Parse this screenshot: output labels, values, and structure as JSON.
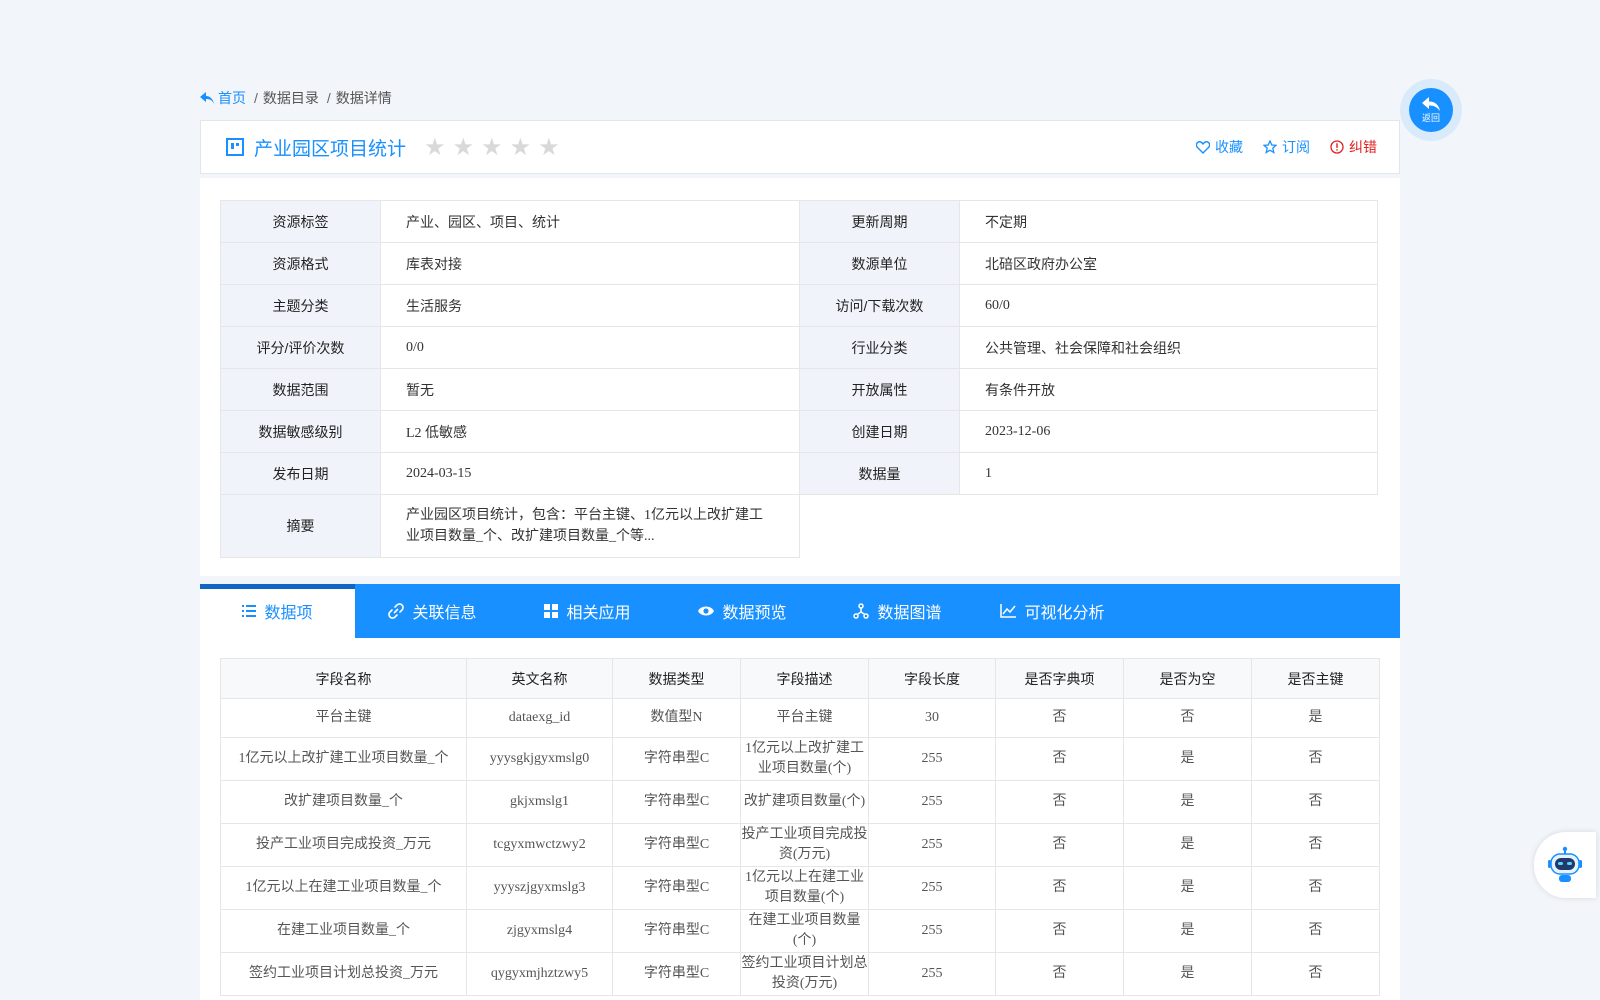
{
  "breadcrumb": {
    "home": "首页",
    "items": [
      "数据目录",
      "数据详情"
    ],
    "separator": "/"
  },
  "header": {
    "title": "产业园区项目统计",
    "rating": 0,
    "rating_max": 5,
    "actions": {
      "favorite": "收藏",
      "subscribe": "订阅",
      "report": "纠错"
    }
  },
  "back_button": {
    "label": "返回"
  },
  "info": {
    "resource_tag_label": "资源标签",
    "resource_tag": "产业、园区、项目、统计",
    "update_cycle_label": "更新周期",
    "update_cycle": "不定期",
    "format_label": "资源格式",
    "format": "库表对接",
    "source_unit_label": "数源单位",
    "source_unit": "北碚区政府办公室",
    "topic_label": "主题分类",
    "topic": "生活服务",
    "visits_label": "访问/下载次数",
    "visits": "60/0",
    "score_label": "评分/评价次数",
    "score": "0/0",
    "industry_label": "行业分类",
    "industry": "公共管理、社会保障和社会组织",
    "scope_label": "数据范围",
    "scope": "暂无",
    "open_label": "开放属性",
    "open": "有条件开放",
    "sensitivity_label": "数据敏感级别",
    "sensitivity": "L2 低敏感",
    "created_label": "创建日期",
    "created": "2023-12-06",
    "published_label": "发布日期",
    "published": "2024-03-15",
    "volume_label": "数据量",
    "volume": "1",
    "summary_label": "摘要",
    "summary": "产业园区项目统计，包含：平台主键、1亿元以上改扩建工业项目数量_个、改扩建项目数量_个等..."
  },
  "tabs": [
    {
      "label": "数据项",
      "icon": "list-icon",
      "active": true
    },
    {
      "label": "关联信息",
      "icon": "link-icon",
      "active": false
    },
    {
      "label": "相关应用",
      "icon": "grid-icon",
      "active": false
    },
    {
      "label": "数据预览",
      "icon": "eye-icon",
      "active": false
    },
    {
      "label": "数据图谱",
      "icon": "graph-icon",
      "active": false
    },
    {
      "label": "可视化分析",
      "icon": "chart-icon",
      "active": false
    }
  ],
  "fields_table": {
    "headers": [
      "字段名称",
      "英文名称",
      "数据类型",
      "字段描述",
      "字段长度",
      "是否字典项",
      "是否为空",
      "是否主键"
    ],
    "rows": [
      [
        "平台主键",
        "dataexg_id",
        "数值型N",
        "平台主键",
        "30",
        "否",
        "否",
        "是"
      ],
      [
        "1亿元以上改扩建工业项目数量_个",
        "yyysgkjgyxmslg0",
        "字符串型C",
        "1亿元以上改扩建工业项目数量(个)",
        "255",
        "否",
        "是",
        "否"
      ],
      [
        "改扩建项目数量_个",
        "gkjxmslg1",
        "字符串型C",
        "改扩建项目数量(个)",
        "255",
        "否",
        "是",
        "否"
      ],
      [
        "投产工业项目完成投资_万元",
        "tcgyxmwctzwy2",
        "字符串型C",
        "投产工业项目完成投资(万元)",
        "255",
        "否",
        "是",
        "否"
      ],
      [
        "1亿元以上在建工业项目数量_个",
        "yyyszjgyxmslg3",
        "字符串型C",
        "1亿元以上在建工业项目数量(个)",
        "255",
        "否",
        "是",
        "否"
      ],
      [
        "在建工业项目数量_个",
        "zjgyxmslg4",
        "字符串型C",
        "在建工业项目数量(个)",
        "255",
        "否",
        "是",
        "否"
      ],
      [
        "签约工业项目计划总投资_万元",
        "qygyxmjhztzwy5",
        "字符串型C",
        "签约工业项目计划总投资(万元)",
        "255",
        "否",
        "是",
        "否"
      ]
    ]
  },
  "colors": {
    "primary": "#1890ff",
    "danger": "#e02020",
    "label_bg": "#f0f4fa"
  }
}
